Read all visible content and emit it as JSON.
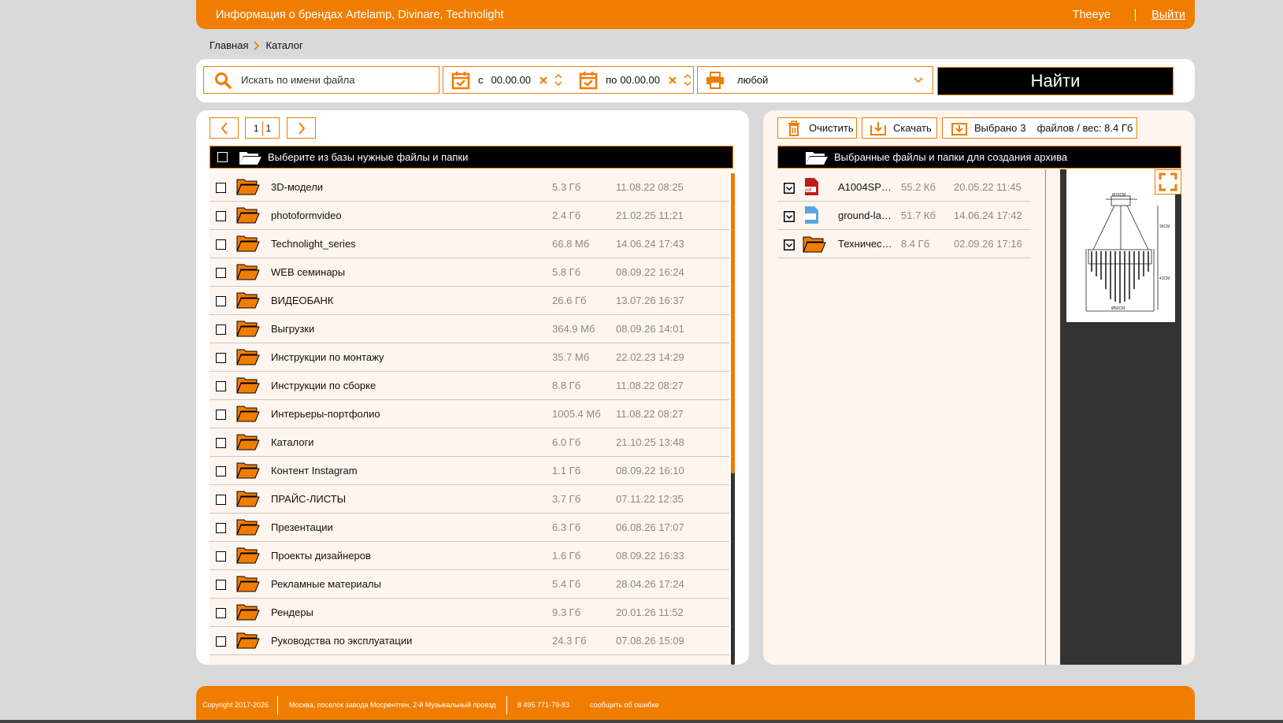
{
  "header": {
    "title": "Информация о брендах Artelamp, Divinare, Technolight",
    "user": "Theeye",
    "logout": "Выйти"
  },
  "breadcrumb": {
    "home": "Главная",
    "current": "Каталог"
  },
  "search": {
    "placeholder": "Искать по имени файла",
    "from_label": "с",
    "from_value": "00.00.00",
    "to_label": "по",
    "to_value": "00.00.00",
    "type_value": "любой",
    "find_label": "Найти"
  },
  "pager": {
    "page": "1",
    "total": "1"
  },
  "left_bar": {
    "label": "Выберите из базы нужные файлы и папки"
  },
  "files": [
    {
      "name": "3D-модели",
      "size": "5.3 Гб",
      "date": "11.08.22 08:25"
    },
    {
      "name": "photoformvideo",
      "size": "2.4 Гб",
      "date": "21.02.25 11:21"
    },
    {
      "name": "Technolight_series",
      "size": "66.8 Мб",
      "date": "14.06.24 17:43"
    },
    {
      "name": "WEB семинары",
      "size": "5.8 Гб",
      "date": "08.09.22 16:24"
    },
    {
      "name": "ВИДЕОБАНК",
      "size": "26.6 Гб",
      "date": "13.07.26 16:37"
    },
    {
      "name": "Выгрузки",
      "size": "364.9 Мб",
      "date": "08.09.26 14:01"
    },
    {
      "name": "Инструкции по монтажу",
      "size": "35.7 Мб",
      "date": "22.02.23 14:29"
    },
    {
      "name": "Инструкции по сборке",
      "size": "8.8 Гб",
      "date": "11.08.22 08:27"
    },
    {
      "name": "Интерьеры-портфолио",
      "size": "1005.4 Мб",
      "date": "11.08.22 08:27"
    },
    {
      "name": "Каталоги",
      "size": "6.0 Гб",
      "date": "21.10.25 13:48"
    },
    {
      "name": "Контент Instagram",
      "size": "1.1 Гб",
      "date": "08.09.22 16:10"
    },
    {
      "name": "ПРАЙС-ЛИСТЫ",
      "size": "3.7 Гб",
      "date": "07.11.22 12:35"
    },
    {
      "name": "Презентации",
      "size": "6.3 Гб",
      "date": "06.08.26 17:07"
    },
    {
      "name": "Проекты дизайнеров",
      "size": "1.6 Гб",
      "date": "08.09.22 16:33"
    },
    {
      "name": "Рекламные материалы",
      "size": "5.4 Гб",
      "date": "28.04.26 17:24"
    },
    {
      "name": "Рендеры",
      "size": "9.3 Гб",
      "date": "20.01.26 11:52"
    },
    {
      "name": "Руководства по эксплуатации",
      "size": "24.3 Гб",
      "date": "07.08.26 15:09"
    }
  ],
  "scroll": {
    "thumb_fraction": 0.61
  },
  "right_buttons": {
    "clear": "Очистить",
    "download": "Скачать",
    "selected_prefix": "Выбрано",
    "selected_count": "3",
    "selected_suffix": "файлов / вес: 8.4 Гб"
  },
  "right_bar": {
    "label": "Выбранные файлы и папки для создания архива"
  },
  "selected": [
    {
      "name": "A1004SP…",
      "size": "55.2 Кб",
      "date": "20.05.22 11:45",
      "icon": "pdf-file-icon",
      "badge": "pdf"
    },
    {
      "name": "ground-la…",
      "size": "51.7 Кб",
      "date": "14.06.24 17:42",
      "icon": "image-file-icon"
    },
    {
      "name": "Техничес…",
      "size": "8.4 Гб",
      "date": "02.09.26 17:16",
      "icon": "folder-icon"
    }
  ],
  "preview": {
    "dim_top": "Ø15CM",
    "dim_right1": "36CM",
    "dim_right2": "41CM",
    "dim_bottom": "Ø50CM"
  },
  "footer": {
    "copyright": "Copyright 2017-2026",
    "address": "Москва, поселок завода Мосрентген, 2-й Музыкальный проезд",
    "phone": "8 495 771-79-83",
    "report": "сообщить об ошибке"
  },
  "colors": {
    "accent": "#f07d00",
    "dark": "#000000",
    "panel_bg": "#fff5ef"
  }
}
